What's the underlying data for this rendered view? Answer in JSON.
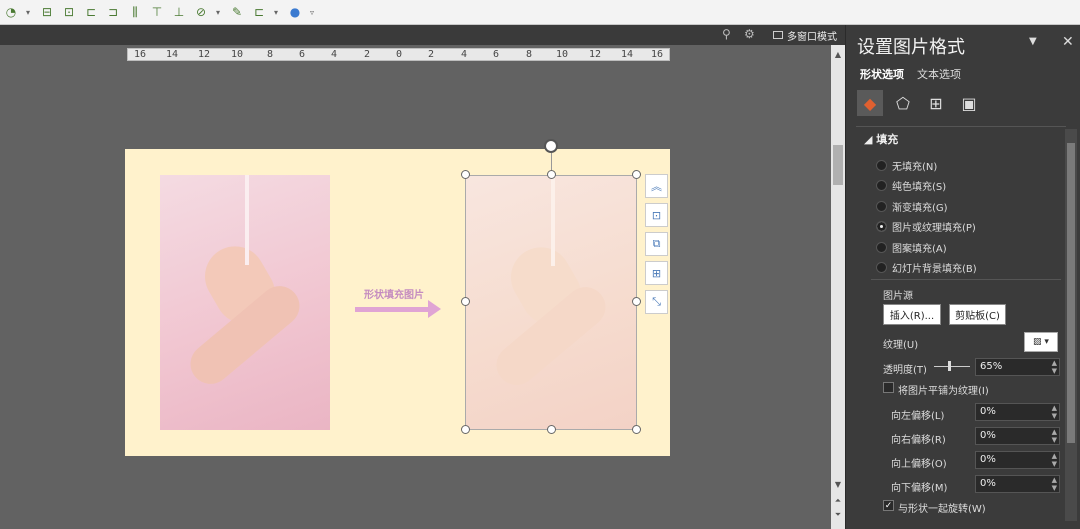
{
  "window": {
    "multi_window_label": "多窗口模式"
  },
  "ruler": {
    "ticks": [
      "16",
      "14",
      "12",
      "10",
      "8",
      "6",
      "4",
      "2",
      "0",
      "2",
      "4",
      "6",
      "8",
      "10",
      "12",
      "14",
      "16"
    ]
  },
  "slide": {
    "arrow_label": "形状填充图片"
  },
  "pane": {
    "title": "设置图片格式",
    "tabs": [
      "形状选项",
      "文本选项"
    ],
    "section": "填充",
    "fill_options": [
      {
        "label": "无填充(N)",
        "selected": false
      },
      {
        "label": "纯色填充(S)",
        "selected": false
      },
      {
        "label": "渐变填充(G)",
        "selected": false
      },
      {
        "label": "图片或纹理填充(P)",
        "selected": true
      },
      {
        "label": "图案填充(A)",
        "selected": false
      },
      {
        "label": "幻灯片背景填充(B)",
        "selected": false
      }
    ],
    "picture_source_label": "图片源",
    "insert_button": "插入(R)...",
    "clipboard_button": "剪贴板(C)",
    "texture_label": "纹理(U)",
    "transparency_label": "透明度(T)",
    "transparency_value": "65%",
    "tile_label": "将图片平铺为纹理(I)",
    "tile_checked": false,
    "offset_left_label": "向左偏移(L)",
    "offset_left_value": "0%",
    "offset_right_label": "向右偏移(R)",
    "offset_right_value": "0%",
    "offset_up_label": "向上偏移(O)",
    "offset_up_value": "0%",
    "offset_down_label": "向下偏移(M)",
    "offset_down_value": "0%",
    "rotate_label": "与形状一起旋转(W)",
    "rotate_checked": true
  }
}
